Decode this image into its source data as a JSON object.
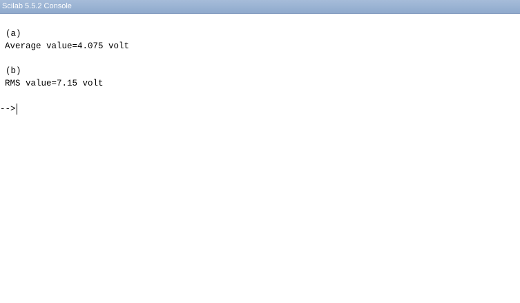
{
  "window": {
    "title": "Scilab 5.5.2 Console"
  },
  "console": {
    "lines": [
      "(a)",
      "Average value=4.075 volt",
      "(b)",
      "RMS value=7.15 volt"
    ],
    "prompt": "-->"
  },
  "colors": {
    "titlebar": "#98b1d2",
    "title_text": "#ffffff",
    "console_background": "#ffffff",
    "console_text": "#000000"
  }
}
